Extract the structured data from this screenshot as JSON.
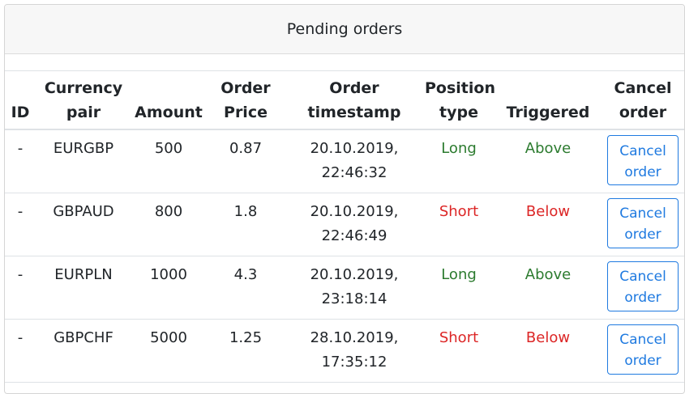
{
  "header": {
    "title": "Pending orders"
  },
  "table": {
    "columns": [
      {
        "line1": "ID",
        "line2": ""
      },
      {
        "line1": "Currency",
        "line2": "pair"
      },
      {
        "line1": "Amount",
        "line2": ""
      },
      {
        "line1": "Order",
        "line2": "Price"
      },
      {
        "line1": "Order",
        "line2": "timestamp"
      },
      {
        "line1": "Position",
        "line2": "type"
      },
      {
        "line1": "Triggered",
        "line2": ""
      },
      {
        "line1": "Cancel",
        "line2": "order"
      }
    ],
    "rows": [
      {
        "id": "-",
        "pair": "EURGBP",
        "amount": "500",
        "price": "0.87",
        "ts1": "20.10.2019,",
        "ts2": "22:46:32",
        "position": "Long",
        "triggered": "Above",
        "cancel1": "Cancel",
        "cancel2": "order"
      },
      {
        "id": "-",
        "pair": "GBPAUD",
        "amount": "800",
        "price": "1.8",
        "ts1": "20.10.2019,",
        "ts2": "22:46:49",
        "position": "Short",
        "triggered": "Below",
        "cancel1": "Cancel",
        "cancel2": "order"
      },
      {
        "id": "-",
        "pair": "EURPLN",
        "amount": "1000",
        "price": "4.3",
        "ts1": "20.10.2019,",
        "ts2": "23:18:14",
        "position": "Long",
        "triggered": "Above",
        "cancel1": "Cancel",
        "cancel2": "order"
      },
      {
        "id": "-",
        "pair": "GBPCHF",
        "amount": "5000",
        "price": "1.25",
        "ts1": "28.10.2019,",
        "ts2": "17:35:12",
        "position": "Short",
        "triggered": "Below",
        "cancel1": "Cancel",
        "cancel2": "order"
      }
    ]
  },
  "colors": {
    "long": "#2c7b2f",
    "short": "#dc2626",
    "button": "#1f7ae0"
  }
}
